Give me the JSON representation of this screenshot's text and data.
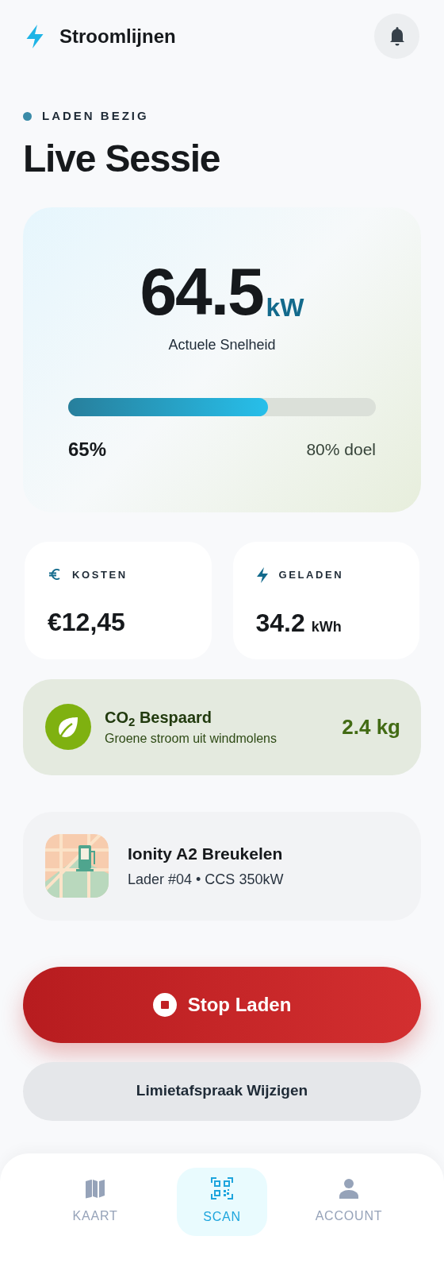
{
  "header": {
    "app_name": "Stroomlijnen"
  },
  "status": {
    "label": "LADEN BEZIG",
    "active": true
  },
  "title": "Live Sessie",
  "speed": {
    "value": "64.5",
    "unit": "kW",
    "label": "Actuele Snelheid"
  },
  "battery": {
    "level": 0.65,
    "reading": "65%",
    "target": "80% doel"
  },
  "stats": [
    {
      "kind": "euro",
      "label": "KOSTEN",
      "value": "€12,45"
    },
    {
      "kind": "bolt",
      "label": "GELADEN",
      "value": "34.2",
      "unit": "kWh"
    }
  ],
  "co2": {
    "title": "CO$_{2}$ Bespaard",
    "subtitle": "Groene stroom uit windmolens",
    "value": "2.4 kg"
  },
  "station": {
    "name": "Ionity A2 Breukelen",
    "detail": "Lader #04 • CCS 350kW"
  },
  "buttons": [
    {
      "kind": "stop",
      "label": "Stop Laden"
    },
    {
      "kind": "secondary",
      "label": "Limietafspraak Wijzigen"
    }
  ],
  "nav": [
    {
      "kind": "map",
      "label": "KAART",
      "selected": false
    },
    {
      "kind": "scan",
      "label": "SCAN",
      "selected": true
    },
    {
      "kind": "person",
      "label": "ACCOUNT",
      "selected": false
    }
  ]
}
